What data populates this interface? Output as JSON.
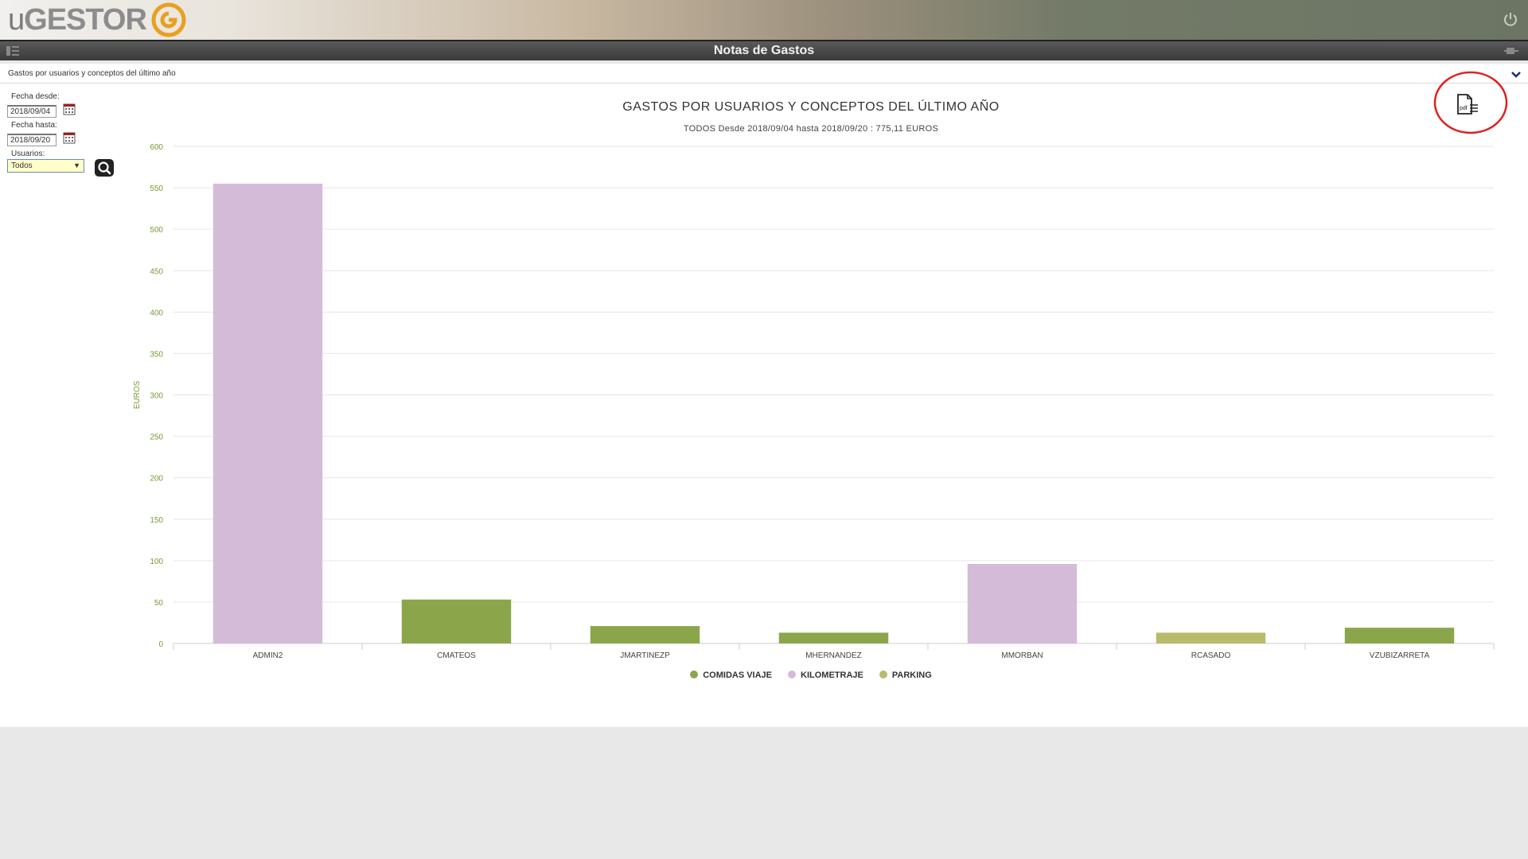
{
  "header": {
    "logo_text_u": "u",
    "logo_text_rest": "GESTOR",
    "page_title": "Notas de Gastos"
  },
  "subbar": {
    "label": "Gastos por usuarios y conceptos del último año"
  },
  "filters": {
    "fecha_desde_label": "Fecha desde:",
    "fecha_desde_value": "2018/09/04",
    "fecha_hasta_label": "Fecha hasta:",
    "fecha_hasta_value": "2018/09/20",
    "usuarios_label": "Usuarios:",
    "usuarios_value": "Todos"
  },
  "colors": {
    "comidas_viaje": "#8ba64a",
    "kilometraje": "#d4bcd8",
    "parking": "#b8bb6a",
    "axis_label": "#7a9a3a",
    "highlight": "#e02020"
  },
  "icons": {
    "power": "power-icon",
    "menu": "menu-icon",
    "pin": "pin-icon",
    "collapse": "chevron-down-icon",
    "calendar": "calendar-icon",
    "search": "search-icon",
    "pdf": "pdf-export-icon"
  },
  "chart_data": {
    "type": "bar",
    "title": "GASTOS POR USUARIOS Y CONCEPTOS DEL ÚLTIMO AÑO",
    "subtitle": "TODOS Desde 2018/09/04 hasta 2018/09/20 : 775,11 EUROS",
    "ylabel": "EUROS",
    "xlabel": "",
    "ylim": [
      0,
      600
    ],
    "yticks": [
      0,
      50,
      100,
      150,
      200,
      250,
      300,
      350,
      400,
      450,
      500,
      550,
      600
    ],
    "grid": true,
    "legend_position": "bottom",
    "categories": [
      "ADMIN2",
      "CMATEOS",
      "JMARTINEZP",
      "MHERNANDEZ",
      "MMORBAN",
      "RCASADO",
      "VZUBIZARRETA"
    ],
    "series": [
      {
        "name": "COMIDAS VIAJE",
        "values": [
          0,
          53,
          21,
          13,
          0,
          0,
          19
        ]
      },
      {
        "name": "KILOMETRAJE",
        "values": [
          555,
          0,
          0,
          0,
          96,
          0,
          0
        ]
      },
      {
        "name": "PARKING",
        "values": [
          0,
          0,
          0,
          0,
          0,
          13,
          0
        ]
      }
    ]
  }
}
